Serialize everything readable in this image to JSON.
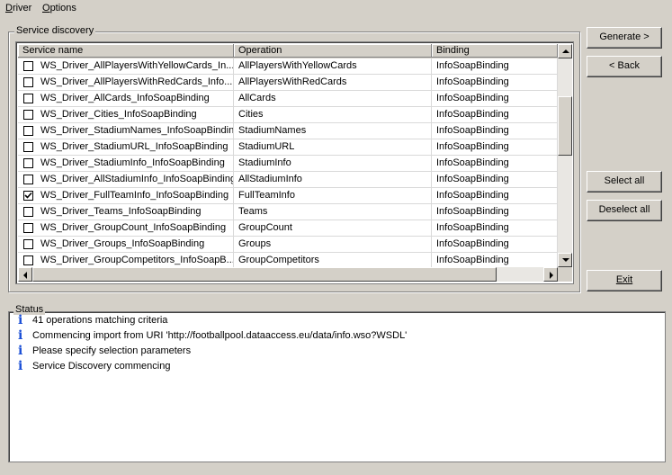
{
  "menu": {
    "items": [
      {
        "label": "Driver",
        "accel": "D",
        "rest": "river"
      },
      {
        "label": "Options",
        "accel": "O",
        "rest": "ptions"
      }
    ]
  },
  "service_discovery": {
    "title": "Service discovery",
    "columns": [
      "Service name",
      "Operation",
      "Binding"
    ],
    "rows": [
      {
        "name": "WS_Driver_AllPlayersWithYellowCards_In...",
        "operation": "AllPlayersWithYellowCards",
        "binding": "InfoSoapBinding",
        "checked": false
      },
      {
        "name": "WS_Driver_AllPlayersWithRedCards_Info...",
        "operation": "AllPlayersWithRedCards",
        "binding": "InfoSoapBinding",
        "checked": false
      },
      {
        "name": "WS_Driver_AllCards_InfoSoapBinding",
        "operation": "AllCards",
        "binding": "InfoSoapBinding",
        "checked": false
      },
      {
        "name": "WS_Driver_Cities_InfoSoapBinding",
        "operation": "Cities",
        "binding": "InfoSoapBinding",
        "checked": false
      },
      {
        "name": "WS_Driver_StadiumNames_InfoSoapBinding",
        "operation": "StadiumNames",
        "binding": "InfoSoapBinding",
        "checked": false
      },
      {
        "name": "WS_Driver_StadiumURL_InfoSoapBinding",
        "operation": "StadiumURL",
        "binding": "InfoSoapBinding",
        "checked": false
      },
      {
        "name": "WS_Driver_StadiumInfo_InfoSoapBinding",
        "operation": "StadiumInfo",
        "binding": "InfoSoapBinding",
        "checked": false
      },
      {
        "name": "WS_Driver_AllStadiumInfo_InfoSoapBinding",
        "operation": "AllStadiumInfo",
        "binding": "InfoSoapBinding",
        "checked": false
      },
      {
        "name": "WS_Driver_FullTeamInfo_InfoSoapBinding",
        "operation": "FullTeamInfo",
        "binding": "InfoSoapBinding",
        "checked": true
      },
      {
        "name": "WS_Driver_Teams_InfoSoapBinding",
        "operation": "Teams",
        "binding": "InfoSoapBinding",
        "checked": false
      },
      {
        "name": "WS_Driver_GroupCount_InfoSoapBinding",
        "operation": "GroupCount",
        "binding": "InfoSoapBinding",
        "checked": false
      },
      {
        "name": "WS_Driver_Groups_InfoSoapBinding",
        "operation": "Groups",
        "binding": "InfoSoapBinding",
        "checked": false
      },
      {
        "name": "WS_Driver_GroupCompetitors_InfoSoapB...",
        "operation": "GroupCompetitors",
        "binding": "InfoSoapBinding",
        "checked": false
      }
    ]
  },
  "buttons": {
    "generate": "Generate >",
    "back": "< Back",
    "select_all": "Select all",
    "deselect_all": "Deselect all",
    "exit": "Exit"
  },
  "status": {
    "title": "Status",
    "icon": "info-icon",
    "icon_color": "#1a4fd6",
    "messages": [
      "41 operations matching criteria",
      "Commencing import from URI 'http://footballpool.dataaccess.eu/data/info.wso?WSDL'",
      "Please specify selection parameters",
      "Service Discovery commencing"
    ]
  }
}
